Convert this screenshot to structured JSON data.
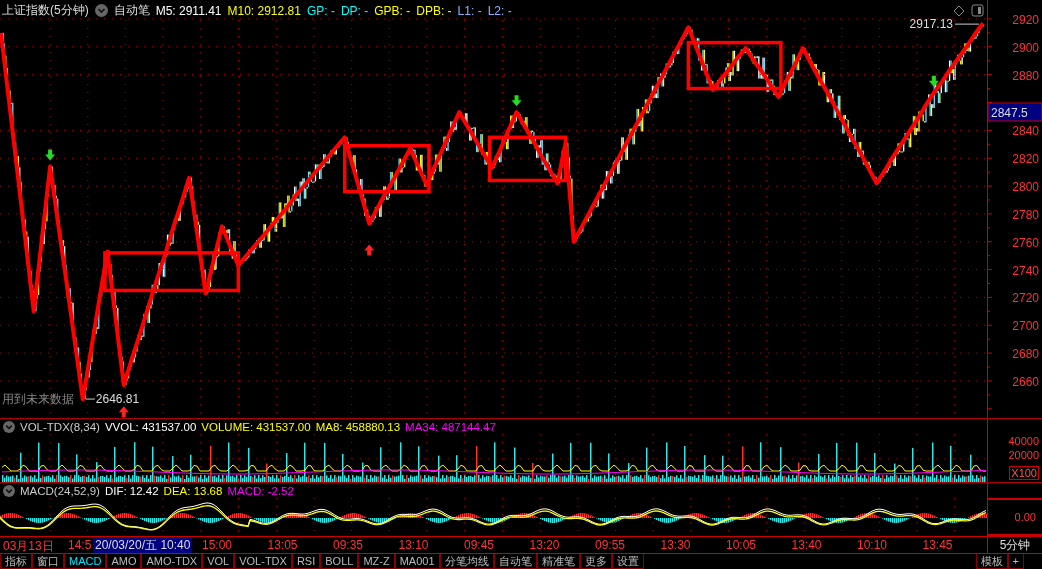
{
  "header": {
    "title": "上证指数(5分钟)",
    "mode": "自动笔",
    "indicators": [
      {
        "label": "M5: 2911.41",
        "color": "#ffffff"
      },
      {
        "label": "M10: 2912.81",
        "color": "#ffff00"
      },
      {
        "label": "GP: -",
        "color": "#00ffff"
      },
      {
        "label": "DP: -",
        "color": "#00ffff"
      },
      {
        "label": "GPB: -",
        "color": "#ffff00"
      },
      {
        "label": "DPB: -",
        "color": "#ffff00"
      },
      {
        "label": "L1: -",
        "color": "#8fb4ff"
      },
      {
        "label": "L2: -",
        "color": "#8fb4ff"
      }
    ]
  },
  "main_chart": {
    "warning": "用到未来数据",
    "cursor_price": "2847.5",
    "low_label": "2646.81",
    "high_label": "2917.13",
    "chart_data": {
      "type": "line",
      "grid": true,
      "ylim": [
        2633.4,
        2933.6
      ],
      "yticks": [
        2920,
        2900,
        2880,
        2840,
        2820,
        2800,
        2780,
        2760,
        2740,
        2720,
        2700,
        2680,
        2660
      ],
      "categories": [
        null,
        null,
        null,
        null,
        null,
        null,
        null,
        null,
        null,
        null,
        null,
        null,
        null,
        null,
        null,
        null,
        null,
        null,
        null,
        null,
        null,
        null,
        null,
        null,
        null,
        null,
        null,
        null,
        null,
        null,
        null,
        null,
        null,
        null,
        null,
        null,
        null,
        null,
        null,
        null,
        null,
        null,
        null,
        null,
        null,
        null,
        null,
        null,
        null,
        null,
        null,
        null,
        null,
        null,
        null,
        null,
        null,
        null,
        null,
        null,
        null,
        null,
        null,
        null,
        null,
        null,
        null,
        null,
        null,
        null,
        null,
        null,
        null,
        null,
        null,
        null,
        null,
        null,
        null,
        null,
        null,
        null,
        null,
        null,
        null,
        null,
        null,
        null,
        null,
        null,
        null,
        null,
        null,
        null,
        null,
        null,
        null,
        null,
        null,
        null,
        null,
        null,
        null,
        null,
        null,
        null,
        null,
        null,
        null,
        null,
        null,
        null,
        null,
        null,
        null,
        null,
        null,
        null,
        null,
        null,
        null
      ],
      "series": [
        {
          "color": "#ff0000",
          "values": [
            2910,
            2860,
            2810,
            2760,
            2710,
            2762,
            2814,
            2772,
            2731,
            2689,
            2647,
            2682,
            2718,
            2753,
            2705,
            2657,
            2676,
            2694,
            2713,
            2732,
            2750,
            2769,
            2787,
            2806,
            2765,
            2723,
            2747,
            2771,
            2757,
            2743,
            2750,
            2757,
            2764,
            2771,
            2778,
            2785,
            2793,
            2800,
            2807,
            2814,
            2821,
            2828,
            2835,
            2814,
            2794,
            2773,
            2784,
            2795,
            2805,
            2816,
            2827,
            2814,
            2801,
            2814,
            2827,
            2840,
            2853,
            2843,
            2833,
            2823,
            2813,
            2826,
            2840,
            2853,
            2843,
            2833,
            2822,
            2812,
            2802,
            2831,
            2760,
            2771,
            2782,
            2793,
            2804,
            2815,
            2826,
            2837,
            2848,
            2859,
            2870,
            2881,
            2892,
            2903,
            2914,
            2899,
            2884,
            2869,
            2877,
            2884,
            2892,
            2899,
            2890,
            2882,
            2873,
            2864,
            2876,
            2887,
            2899,
            2888,
            2877,
            2867,
            2856,
            2845,
            2834,
            2824,
            2813,
            2802,
            2811,
            2821,
            2830,
            2839,
            2848,
            2858,
            2867,
            2875,
            2884,
            2892,
            2900,
            2909,
            2917
          ]
        }
      ]
    }
  },
  "volume": {
    "title": "VOL-TDX(8,34)",
    "values": [
      {
        "label": "VVOL: 431537.00",
        "color": "#ffffff"
      },
      {
        "label": "VOLUME: 431537.00",
        "color": "#ffff00"
      },
      {
        "label": "MA8: 458880.13",
        "color": "#ffff00"
      },
      {
        "label": "MA34: 487144.47",
        "color": "#ff00ff"
      }
    ],
    "yticks": [
      "40000",
      "20000"
    ],
    "unit": "X100"
  },
  "macd": {
    "title": "MACD(24,52,9)",
    "values": [
      {
        "label": "DIF: 12.42",
        "color": "#ffffff"
      },
      {
        "label": "DEA: 13.68",
        "color": "#ffff00"
      },
      {
        "label": "MACD: -2.52",
        "color": "#ff00ff"
      }
    ],
    "yticks": [
      "0.00"
    ]
  },
  "x_axis": {
    "labels": [
      "03月13日",
      "14:5",
      "15:00",
      "13:05",
      "09:35",
      "13:10",
      "09:45",
      "13:20",
      "09:55",
      "13:30",
      "10:05",
      "13:40",
      "10:10",
      "13:45"
    ],
    "cursor_label": "20/03/20/五 10:40",
    "period": "5分钟"
  },
  "tabs": [
    {
      "label": "指标",
      "selected": false
    },
    {
      "label": "窗口",
      "selected": false
    },
    {
      "label": "MACD",
      "selected": true
    },
    {
      "label": "AMO",
      "selected": false
    },
    {
      "label": "AMO-TDX",
      "selected": false
    },
    {
      "label": "VOL",
      "selected": false
    },
    {
      "label": "VOL-TDX",
      "selected": false
    },
    {
      "label": "RSI",
      "selected": false
    },
    {
      "label": "BOLL",
      "selected": false
    },
    {
      "label": "MZ-Z",
      "selected": false
    },
    {
      "label": "MA001",
      "selected": false
    },
    {
      "label": "分笔均线",
      "selected": false
    },
    {
      "label": "自动笔",
      "selected": false
    },
    {
      "label": "精准笔",
      "selected": false
    },
    {
      "label": "更多",
      "selected": false
    },
    {
      "label": "设置",
      "selected": false
    }
  ],
  "right_tabs": [
    "模板",
    "+"
  ]
}
